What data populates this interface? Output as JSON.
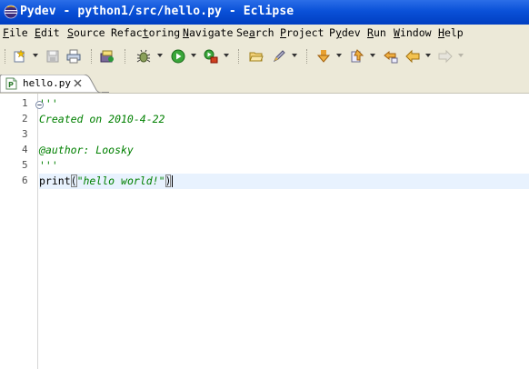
{
  "window": {
    "title": "Pydev - python1/src/hello.py - Eclipse",
    "app_icon": "eclipse-icon"
  },
  "menu": [
    {
      "label": "File",
      "mnemonic": "F",
      "rest": "ile"
    },
    {
      "label": "Edit",
      "mnemonic": "E",
      "rest": "dit"
    },
    {
      "label": "Source",
      "mnemonic": "S",
      "rest": "ource"
    },
    {
      "label": "Refactoring",
      "mnemonic": "t",
      "pre": "Refac",
      "rest": "oring"
    },
    {
      "label": "Navigate",
      "mnemonic": "N",
      "rest": "avigate"
    },
    {
      "label": "Search",
      "mnemonic": "a",
      "pre": "Se",
      "rest": "rch"
    },
    {
      "label": "Project",
      "mnemonic": "P",
      "rest": "roject"
    },
    {
      "label": "Pydev",
      "mnemonic": "y",
      "pre": "P",
      "rest": "dev"
    },
    {
      "label": "Run",
      "mnemonic": "R",
      "rest": "un"
    },
    {
      "label": "Window",
      "mnemonic": "W",
      "rest": "indow"
    },
    {
      "label": "Help",
      "mnemonic": "H",
      "rest": "elp"
    }
  ],
  "toolbar": {
    "icons": [
      "new-icon",
      "save-icon",
      "print-icon",
      "open-type-icon",
      "debug-icon",
      "run-icon",
      "external-tools-icon",
      "open-folder-icon",
      "pen-icon",
      "next-annotation-icon",
      "previous-annotation-icon",
      "last-edit-icon",
      "back-icon",
      "forward-icon"
    ]
  },
  "editor_tab": {
    "label": "hello.py",
    "icon": "python-file-icon"
  },
  "code": {
    "line_numbers": [
      "1",
      "2",
      "3",
      "4",
      "5",
      "6"
    ],
    "lines": [
      {
        "text": "'''"
      },
      {
        "text": "Created on 2010-4-22"
      },
      {
        "text": ""
      },
      {
        "text": "@author: Loosky"
      },
      {
        "text": "'''"
      },
      {
        "kw": "print",
        "open": "(",
        "string": "\"hello world!\"",
        "close": ")"
      }
    ],
    "current_line": 6
  },
  "colors": {
    "titlebar": "#0a51d8",
    "chrome": "#ece9d8",
    "string": "#008000",
    "current_line": "#e8f2fe"
  }
}
